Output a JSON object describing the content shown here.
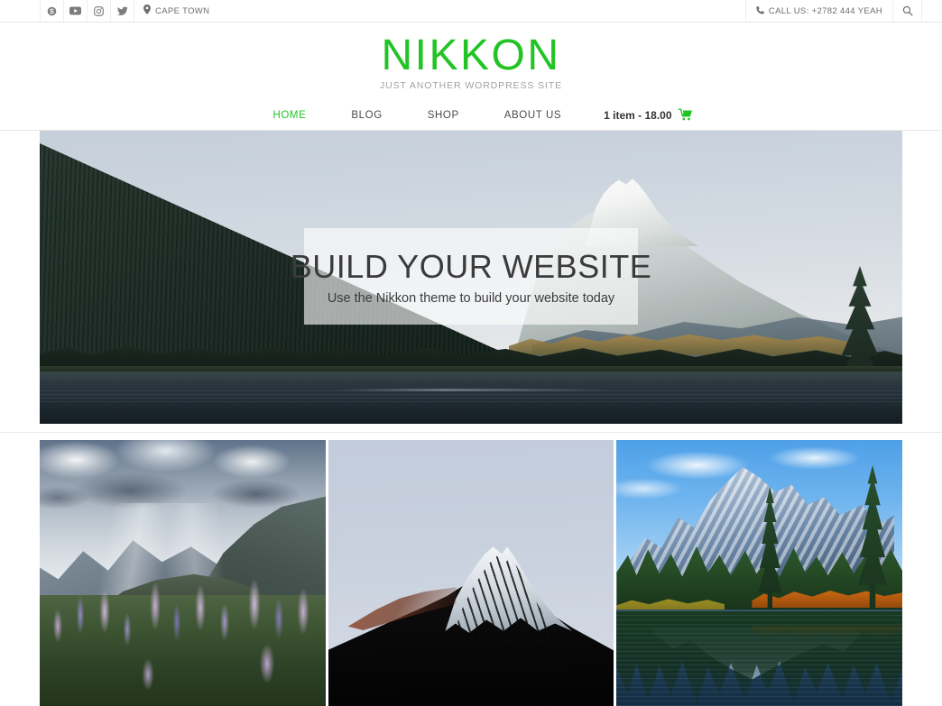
{
  "topbar": {
    "social": [
      {
        "name": "skype-icon",
        "label": "Skype"
      },
      {
        "name": "youtube-icon",
        "label": "YouTube"
      },
      {
        "name": "instagram-icon",
        "label": "Instagram"
      },
      {
        "name": "twitter-icon",
        "label": "Twitter"
      }
    ],
    "location": "CAPE TOWN",
    "phone": "CALL US: +2782 444 YEAH",
    "search_label": "Search"
  },
  "brand": {
    "title": "NIKKON",
    "tagline": "JUST ANOTHER WORDPRESS SITE",
    "accent_color": "#22c425"
  },
  "nav": {
    "items": [
      {
        "label": "HOME",
        "active": true
      },
      {
        "label": "BLOG",
        "active": false
      },
      {
        "label": "SHOP",
        "active": false
      },
      {
        "label": "ABOUT US",
        "active": false
      }
    ],
    "cart": {
      "count_label": "1 item",
      "separator": "-",
      "total": "18.00",
      "full_label": "1 item - 18.00"
    }
  },
  "hero": {
    "title": "BUILD YOUR WEBSITE",
    "subtitle": "Use the Nikkon theme to build your website today",
    "image_alt": "Mountain lake with snow-capped peak and forested slope"
  },
  "gallery": [
    {
      "alt": "Purple lupine flower field with mountains and sun rays"
    },
    {
      "alt": "Dark volcanic snow-capped mountain peak against pale sky"
    },
    {
      "alt": "Snowy mountain reflected in a lake with evergreen and autumn trees"
    }
  ]
}
